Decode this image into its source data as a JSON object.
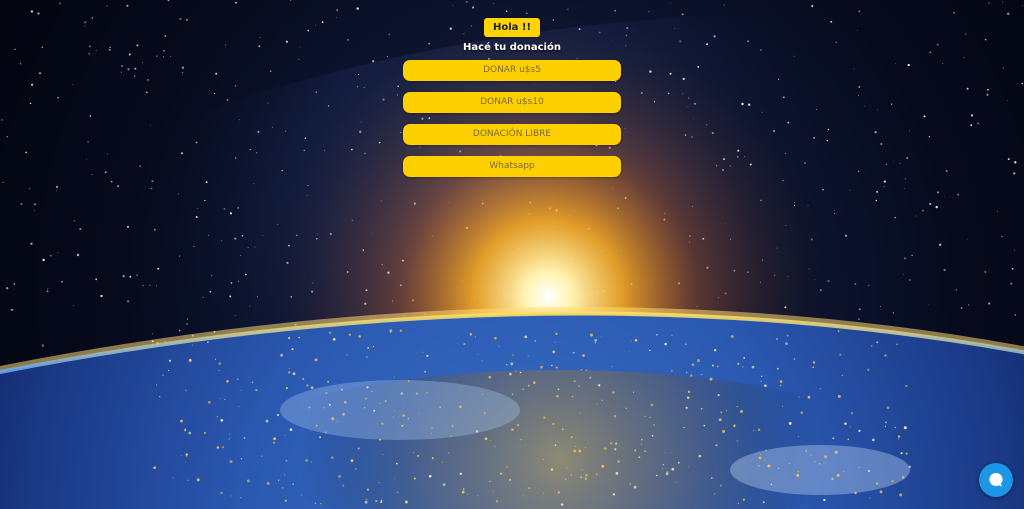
{
  "header": {
    "greeting": "Hola !!",
    "subtitle": "Hacé tu donación"
  },
  "buttons": [
    {
      "label": "DONAR u$s5"
    },
    {
      "label": "DONAR u$s10"
    },
    {
      "label": "DONACIÓN LIBRE"
    },
    {
      "label": "Whatsapp"
    }
  ],
  "chat": {
    "icon": "chat-bubble-icon"
  },
  "colors": {
    "button": "#ffd000",
    "button_text": "#7a6a2e",
    "chat": "#1e96e6"
  }
}
